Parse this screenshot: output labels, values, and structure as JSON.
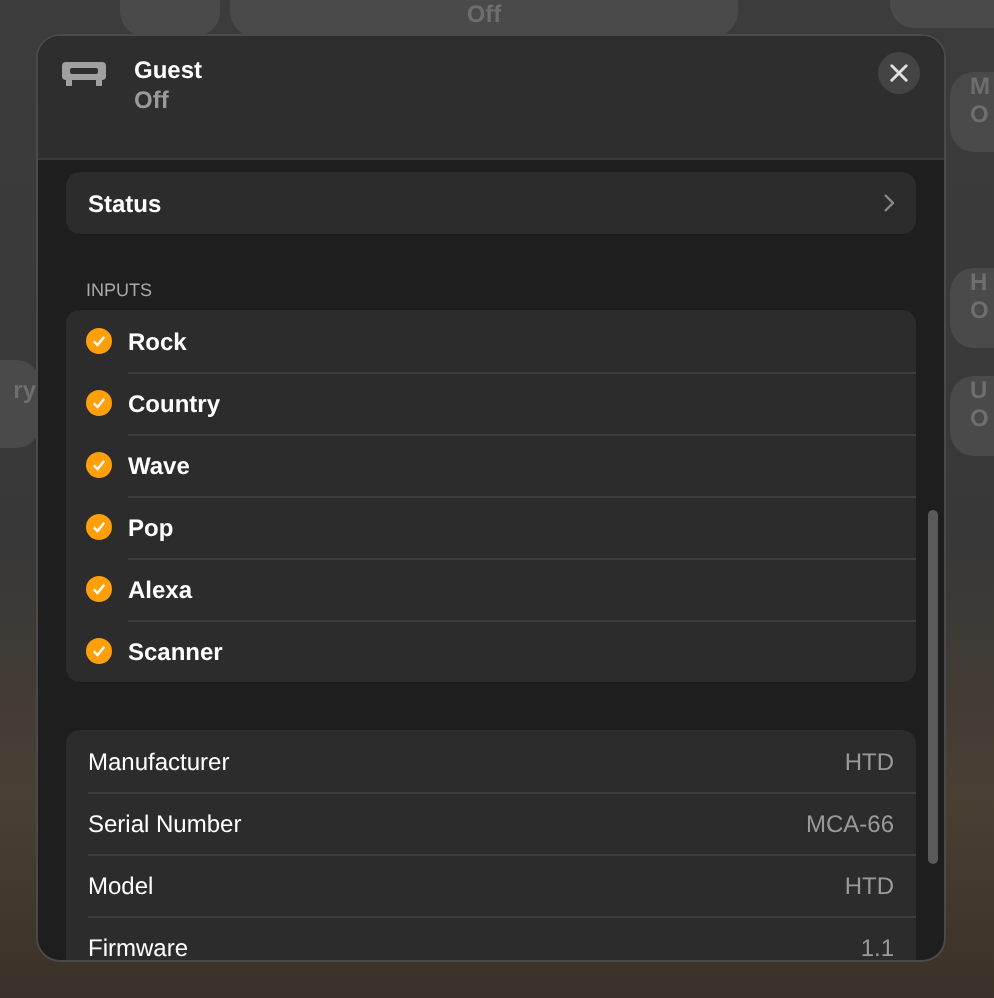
{
  "background": {
    "tiles": [
      {
        "lines": [
          "Off"
        ]
      },
      {
        "lines": [
          "M",
          "O"
        ]
      },
      {
        "lines": [
          "H",
          "O"
        ]
      },
      {
        "lines": [
          "U",
          "O"
        ]
      },
      {
        "lines": [
          "ry"
        ]
      }
    ]
  },
  "dialog": {
    "title": "Guest",
    "subtitle": "Off",
    "status": {
      "label": "Status"
    },
    "inputs": {
      "heading": "INPUTS",
      "items": [
        {
          "label": "Rock",
          "checked": true
        },
        {
          "label": "Country",
          "checked": true
        },
        {
          "label": "Wave",
          "checked": true
        },
        {
          "label": "Pop",
          "checked": true
        },
        {
          "label": "Alexa",
          "checked": true
        },
        {
          "label": "Scanner",
          "checked": true
        }
      ]
    },
    "info": [
      {
        "label": "Manufacturer",
        "value": "HTD"
      },
      {
        "label": "Serial Number",
        "value": "MCA-66"
      },
      {
        "label": "Model",
        "value": "HTD"
      },
      {
        "label": "Firmware",
        "value": "1.1"
      }
    ]
  }
}
